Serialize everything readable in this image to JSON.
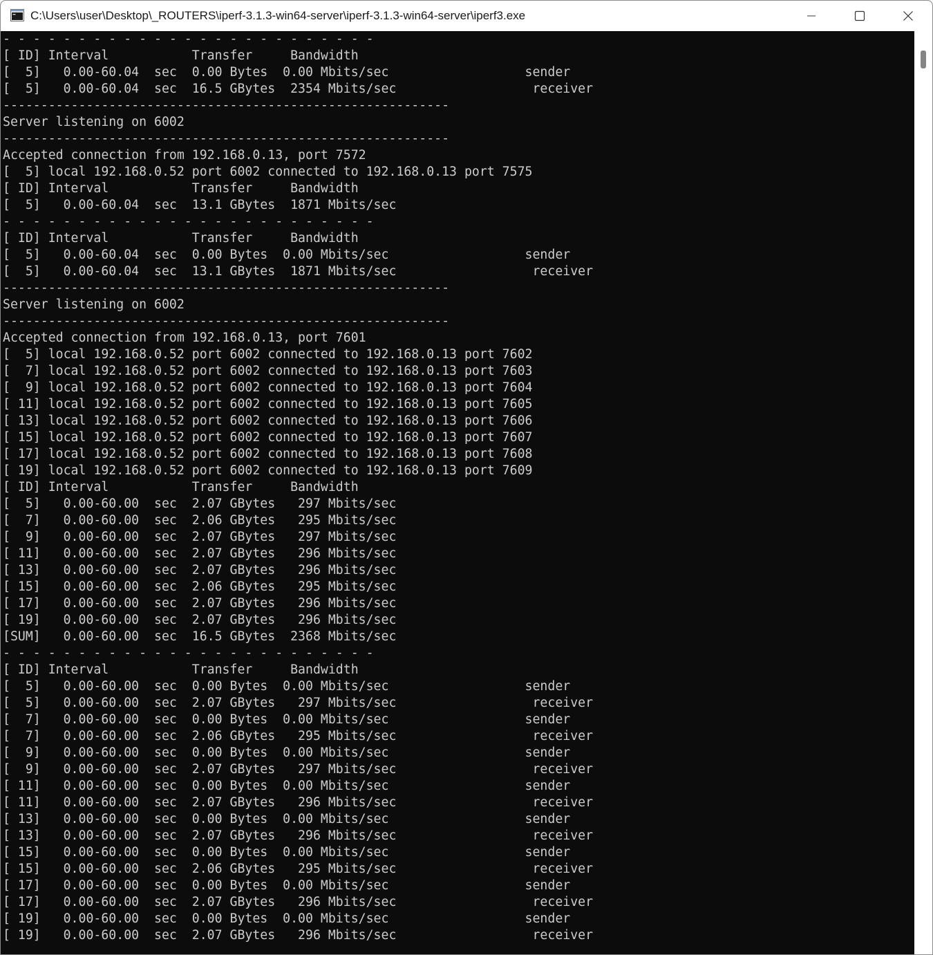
{
  "window": {
    "title": "C:\\Users\\user\\Desktop\\_ROUTERS\\iperf-3.1.3-win64-server\\iperf-3.1.3-win64-server\\iperf3.exe",
    "app_icon": "console-app-icon",
    "controls": {
      "minimize": "minimize-icon",
      "maximize": "maximize-icon",
      "close": "close-icon"
    }
  },
  "console": {
    "colors": {
      "background": "#0c0c0c",
      "text": "#cccccc"
    },
    "lines": [
      "- - - - - - - - - - - - - - - - - - - - - - - - -",
      "[ ID] Interval           Transfer     Bandwidth",
      "[  5]   0.00-60.04  sec  0.00 Bytes  0.00 Mbits/sec                  sender",
      "[  5]   0.00-60.04  sec  16.5 GBytes  2354 Mbits/sec                  receiver",
      "-----------------------------------------------------------",
      "Server listening on 6002",
      "-----------------------------------------------------------",
      "Accepted connection from 192.168.0.13, port 7572",
      "[  5] local 192.168.0.52 port 6002 connected to 192.168.0.13 port 7575",
      "[ ID] Interval           Transfer     Bandwidth",
      "[  5]   0.00-60.04  sec  13.1 GBytes  1871 Mbits/sec",
      "- - - - - - - - - - - - - - - - - - - - - - - - -",
      "[ ID] Interval           Transfer     Bandwidth",
      "[  5]   0.00-60.04  sec  0.00 Bytes  0.00 Mbits/sec                  sender",
      "[  5]   0.00-60.04  sec  13.1 GBytes  1871 Mbits/sec                  receiver",
      "-----------------------------------------------------------",
      "Server listening on 6002",
      "-----------------------------------------------------------",
      "Accepted connection from 192.168.0.13, port 7601",
      "[  5] local 192.168.0.52 port 6002 connected to 192.168.0.13 port 7602",
      "[  7] local 192.168.0.52 port 6002 connected to 192.168.0.13 port 7603",
      "[  9] local 192.168.0.52 port 6002 connected to 192.168.0.13 port 7604",
      "[ 11] local 192.168.0.52 port 6002 connected to 192.168.0.13 port 7605",
      "[ 13] local 192.168.0.52 port 6002 connected to 192.168.0.13 port 7606",
      "[ 15] local 192.168.0.52 port 6002 connected to 192.168.0.13 port 7607",
      "[ 17] local 192.168.0.52 port 6002 connected to 192.168.0.13 port 7608",
      "[ 19] local 192.168.0.52 port 6002 connected to 192.168.0.13 port 7609",
      "[ ID] Interval           Transfer     Bandwidth",
      "[  5]   0.00-60.00  sec  2.07 GBytes   297 Mbits/sec",
      "[  7]   0.00-60.00  sec  2.06 GBytes   295 Mbits/sec",
      "[  9]   0.00-60.00  sec  2.07 GBytes   297 Mbits/sec",
      "[ 11]   0.00-60.00  sec  2.07 GBytes   296 Mbits/sec",
      "[ 13]   0.00-60.00  sec  2.07 GBytes   296 Mbits/sec",
      "[ 15]   0.00-60.00  sec  2.06 GBytes   295 Mbits/sec",
      "[ 17]   0.00-60.00  sec  2.07 GBytes   296 Mbits/sec",
      "[ 19]   0.00-60.00  sec  2.07 GBytes   296 Mbits/sec",
      "[SUM]   0.00-60.00  sec  16.5 GBytes  2368 Mbits/sec",
      "- - - - - - - - - - - - - - - - - - - - - - - - -",
      "[ ID] Interval           Transfer     Bandwidth",
      "[  5]   0.00-60.00  sec  0.00 Bytes  0.00 Mbits/sec                  sender",
      "[  5]   0.00-60.00  sec  2.07 GBytes   297 Mbits/sec                  receiver",
      "[  7]   0.00-60.00  sec  0.00 Bytes  0.00 Mbits/sec                  sender",
      "[  7]   0.00-60.00  sec  2.06 GBytes   295 Mbits/sec                  receiver",
      "[  9]   0.00-60.00  sec  0.00 Bytes  0.00 Mbits/sec                  sender",
      "[  9]   0.00-60.00  sec  2.07 GBytes   297 Mbits/sec                  receiver",
      "[ 11]   0.00-60.00  sec  0.00 Bytes  0.00 Mbits/sec                  sender",
      "[ 11]   0.00-60.00  sec  2.07 GBytes   296 Mbits/sec                  receiver",
      "[ 13]   0.00-60.00  sec  0.00 Bytes  0.00 Mbits/sec                  sender",
      "[ 13]   0.00-60.00  sec  2.07 GBytes   296 Mbits/sec                  receiver",
      "[ 15]   0.00-60.00  sec  0.00 Bytes  0.00 Mbits/sec                  sender",
      "[ 15]   0.00-60.00  sec  2.06 GBytes   295 Mbits/sec                  receiver",
      "[ 17]   0.00-60.00  sec  0.00 Bytes  0.00 Mbits/sec                  sender",
      "[ 17]   0.00-60.00  sec  2.07 GBytes   296 Mbits/sec                  receiver",
      "[ 19]   0.00-60.00  sec  0.00 Bytes  0.00 Mbits/sec                  sender",
      "[ 19]   0.00-60.00  sec  2.07 GBytes   296 Mbits/sec                  receiver"
    ]
  }
}
